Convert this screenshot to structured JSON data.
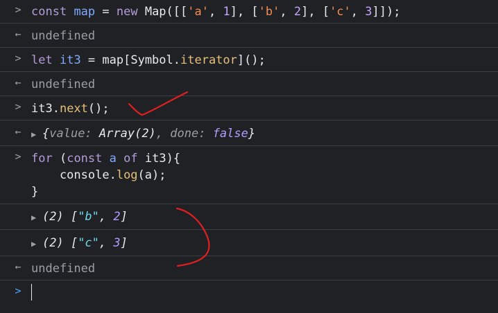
{
  "console": {
    "prompt_glyph": ">",
    "result_glyph": "←",
    "undefined_text": "undefined",
    "line1": {
      "t1": "const",
      "t2": "map",
      "t3": " = ",
      "t4": "new",
      "t5": " Map([[",
      "t6": "'a'",
      "t7": ", ",
      "t8": "1",
      "t9": "], [",
      "t10": "'b'",
      "t11": ", ",
      "t12": "2",
      "t13": "], [",
      "t14": "'c'",
      "t15": ", ",
      "t16": "3",
      "t17": "]]);"
    },
    "line2": {
      "t1": "let",
      "t2": "it3",
      "t3": " = ",
      "t4": "map[Symbol.",
      "t5": "iterator",
      "t6": "]();"
    },
    "line3": {
      "t1": "it3.",
      "t2": "next",
      "t3": "();"
    },
    "line4": {
      "t1": "{",
      "t2": "value: ",
      "t3": "Array(2)",
      "t4": ", done: ",
      "t5": "false",
      "t6": "}"
    },
    "line5": {
      "a1": "for",
      "a2": " (",
      "a3": "const",
      "a4": " ",
      "a5": "a",
      "a6": " ",
      "a7": "of",
      "a8": " it3){",
      "b1": "    console.",
      "b2": "log",
      "b3": "(a);",
      "c1": "}"
    },
    "out1": {
      "t1": "(2) [",
      "t2": "\"b\"",
      "t3": ", ",
      "t4": "2",
      "t5": "]"
    },
    "out2": {
      "t1": "(2) [",
      "t2": "\"c\"",
      "t3": ", ",
      "t4": "3",
      "t5": "]"
    },
    "annotation_color": "#e02020"
  }
}
